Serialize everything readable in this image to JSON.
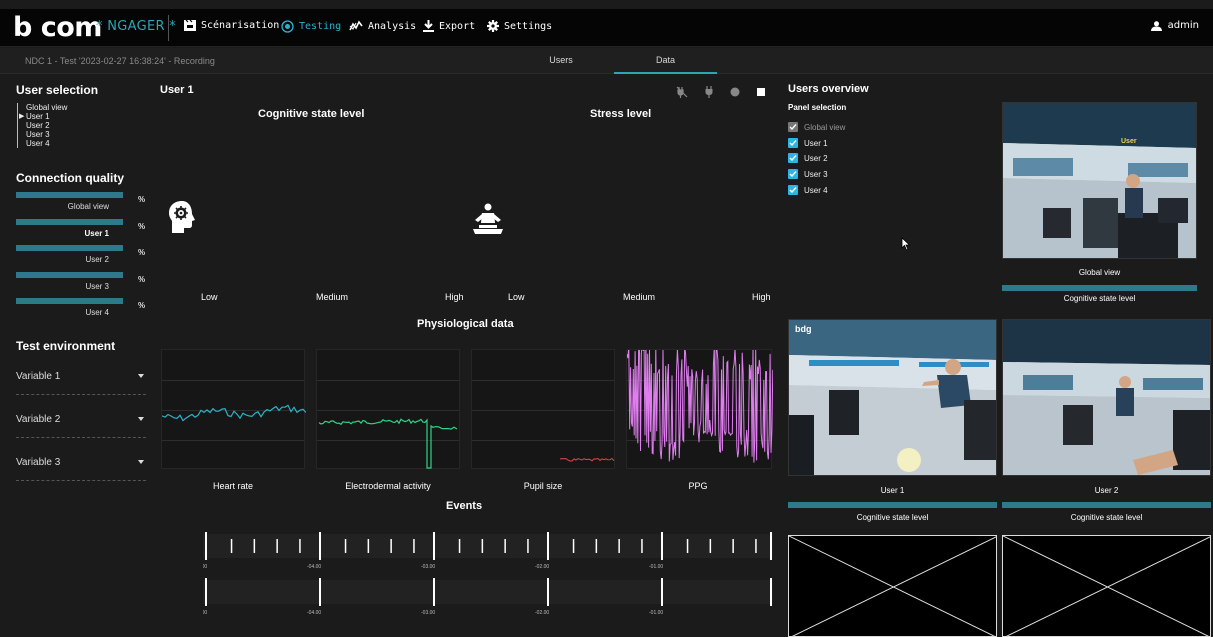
{
  "app": {
    "logo": "b com",
    "product": "* NGAGER *",
    "nav": [
      {
        "label": "Scénarisation",
        "icon": "scenario-icon"
      },
      {
        "label": "Testing",
        "icon": "record-icon",
        "active": true
      },
      {
        "label": "Analysis",
        "icon": "analysis-icon"
      },
      {
        "label": "Export",
        "icon": "download-icon"
      },
      {
        "label": "Settings",
        "icon": "gear-icon"
      }
    ],
    "user": "admin",
    "accent": "#27b3cf"
  },
  "subbar": {
    "session": "NDC 1 - Test '2023-02-27 16:38:24' - Recording",
    "tabs": [
      "Users",
      "Data"
    ],
    "active_tab": "Data"
  },
  "left": {
    "user_selection_title": "User selection",
    "user_list": [
      "Global view",
      "User 1",
      "User 2",
      "User 3",
      "User 4"
    ],
    "selected_user": "User 1",
    "connection_title": "Connection quality",
    "connection": [
      {
        "name": "Global view",
        "value": "%"
      },
      {
        "name": "User 1",
        "value": "%"
      },
      {
        "name": "User 2",
        "value": "%"
      },
      {
        "name": "User 3",
        "value": "%"
      },
      {
        "name": "User 4",
        "value": "%"
      }
    ],
    "env_title": "Test environment",
    "variables": [
      "Variable 1",
      "Variable 2",
      "Variable 3"
    ]
  },
  "center": {
    "user_title": "User 1",
    "cognitive_title": "Cognitive state level",
    "stress_title": "Stress level",
    "cognitive_levels": [
      "Low",
      "Medium",
      "High"
    ],
    "stress_levels": [
      "Low",
      "Medium",
      "High"
    ],
    "phys_title": "Physiological data",
    "phys_labels": [
      "Heart rate",
      "Electrodermal activity",
      "Pupil size",
      "PPG"
    ],
    "phys_colors": [
      "#2bb3c8",
      "#2fd484",
      "#e04848",
      "#e07ef0"
    ],
    "events_title": "Events",
    "timeline_ticks": [
      "-05.00",
      "-04.00",
      "-03.00",
      "-02.00",
      "-01.00"
    ]
  },
  "right": {
    "overview_title": "Users overview",
    "panel_selection": "Panel selection",
    "panels": [
      {
        "label": "Global view",
        "checked": true,
        "disabled": true
      },
      {
        "label": "User 1",
        "checked": true
      },
      {
        "label": "User 2",
        "checked": true
      },
      {
        "label": "User 3",
        "checked": true
      },
      {
        "label": "User 4",
        "checked": true
      }
    ],
    "thumbs": [
      {
        "name": "Global view",
        "metric": "Cognitive state level",
        "overlay": "User"
      },
      {
        "name": "User 1",
        "metric": "Cognitive state level",
        "overlay": "bdg"
      },
      {
        "name": "User 2",
        "metric": "Cognitive state level"
      }
    ]
  }
}
